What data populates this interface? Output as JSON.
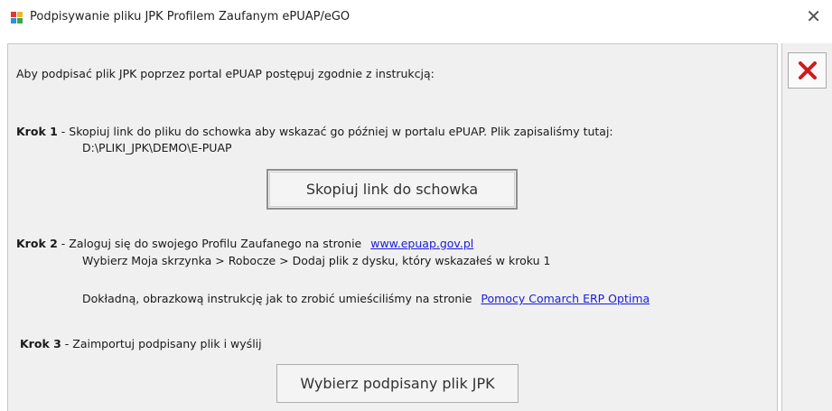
{
  "window": {
    "title": "Podpisywanie pliku JPK Profilem Zaufanym ePUAP/eGO",
    "close_glyph": "✕"
  },
  "intro": "Aby podpisać plik JPK poprzez portal ePUAP postępuj zgodnie z instrukcją:",
  "step1": {
    "label": "Krok 1",
    "text": " - Skopiuj link do pliku do schowka aby wskazać go później w portalu ePUAP. Plik zapisaliśmy tutaj:",
    "path": "D:\\PLIKI_JPK\\DEMO\\E-PUAP",
    "button_label": "Skopiuj link do schowka"
  },
  "step2": {
    "label": "Krok 2",
    "text": " - Zaloguj się do swojego Profilu Zaufanego na stronie",
    "link": "www.epuap.gov.pl",
    "line2": "Wybierz Moja skrzynka > Robocze > Dodaj plik z dysku, który wskazałeś w kroku 1",
    "line3": "Dokładną, obrazkową instrukcję jak to zrobić umieściliśmy na stronie",
    "help_link": "Pomocy Comarch ERP Optima"
  },
  "step3": {
    "label": "Krok 3",
    "text": " - Zaimportuj podpisany plik i wyślij",
    "button_label": "Wybierz podpisany plik JPK"
  },
  "colors": {
    "link": "#1a1adc",
    "cancel_x": "#d11a1a",
    "panel_bg": "#f0f0f0"
  },
  "icons": {
    "app": "jpk-app-icon",
    "cancel": "red-x-icon"
  }
}
